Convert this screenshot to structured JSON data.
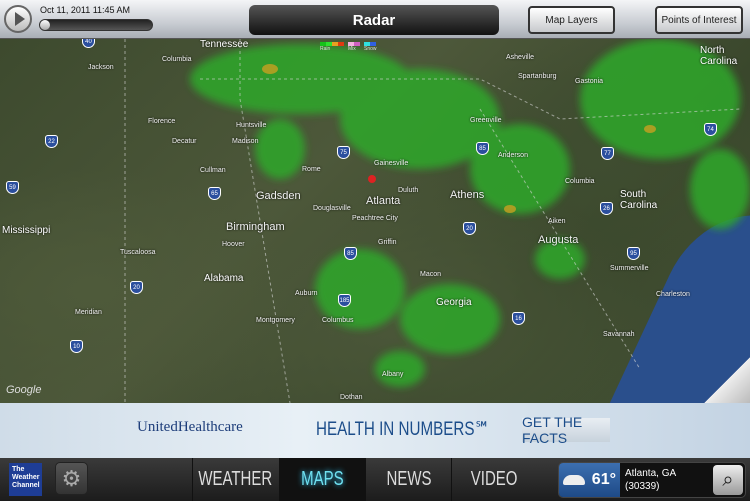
{
  "topbar": {
    "timestamp": "Oct 11, 2011 11:45 AM",
    "title": "Radar",
    "map_layers": "Map Layers",
    "points_of_interest": "Points of Interest",
    "progress": 0
  },
  "legend": {
    "rain": "Rain",
    "mix": "Mix",
    "snow": "Snow",
    "rain_colors": [
      "#16c21a",
      "#2ee02e",
      "#e8a020",
      "#e03a10"
    ],
    "mix_colors": [
      "#f5b0e0",
      "#d060c0"
    ],
    "snow_colors": [
      "#30e0e0",
      "#3060e0"
    ]
  },
  "map": {
    "states": [
      "Tennessee",
      "Mississippi",
      "Alabama",
      "Georgia",
      "South Carolina",
      "North Carolina"
    ],
    "cities": [
      "Jackson",
      "Columbia",
      "Florence",
      "Decatur",
      "Huntsville",
      "Madison",
      "Cullman",
      "Gadsden",
      "Rome",
      "Gainesville",
      "Atlanta",
      "Duluth",
      "Douglasville",
      "Athens",
      "Anderson",
      "Greenville",
      "Spartanburg",
      "Asheville",
      "Columbia",
      "Aiken",
      "Augusta",
      "Birmingham",
      "Hoover",
      "Tuscaloosa",
      "Meridian",
      "Auburn",
      "Montgomery",
      "Columbus",
      "Macon",
      "Albany",
      "Dothan",
      "Savannah",
      "Charleston",
      "Summerville",
      "Peachtree City",
      "Griffin",
      "Gastonia"
    ],
    "interstates": [
      "40",
      "22",
      "65",
      "59",
      "20",
      "75",
      "85",
      "85",
      "20",
      "26",
      "77",
      "95",
      "16",
      "185",
      "10",
      "74"
    ],
    "google": "Google"
  },
  "ad": {
    "brand": "UnitedHealthcare",
    "headline": "HEALTH IN NUMBERS℠",
    "cta": "GET THE FACTS"
  },
  "nav": {
    "logo": "The Weather Channel",
    "tabs": [
      "WEATHER",
      "MAPS",
      "NEWS",
      "VIDEO"
    ],
    "active": "MAPS",
    "temperature": "61°",
    "location": "Atlanta, GA",
    "zip": "(30339)"
  }
}
